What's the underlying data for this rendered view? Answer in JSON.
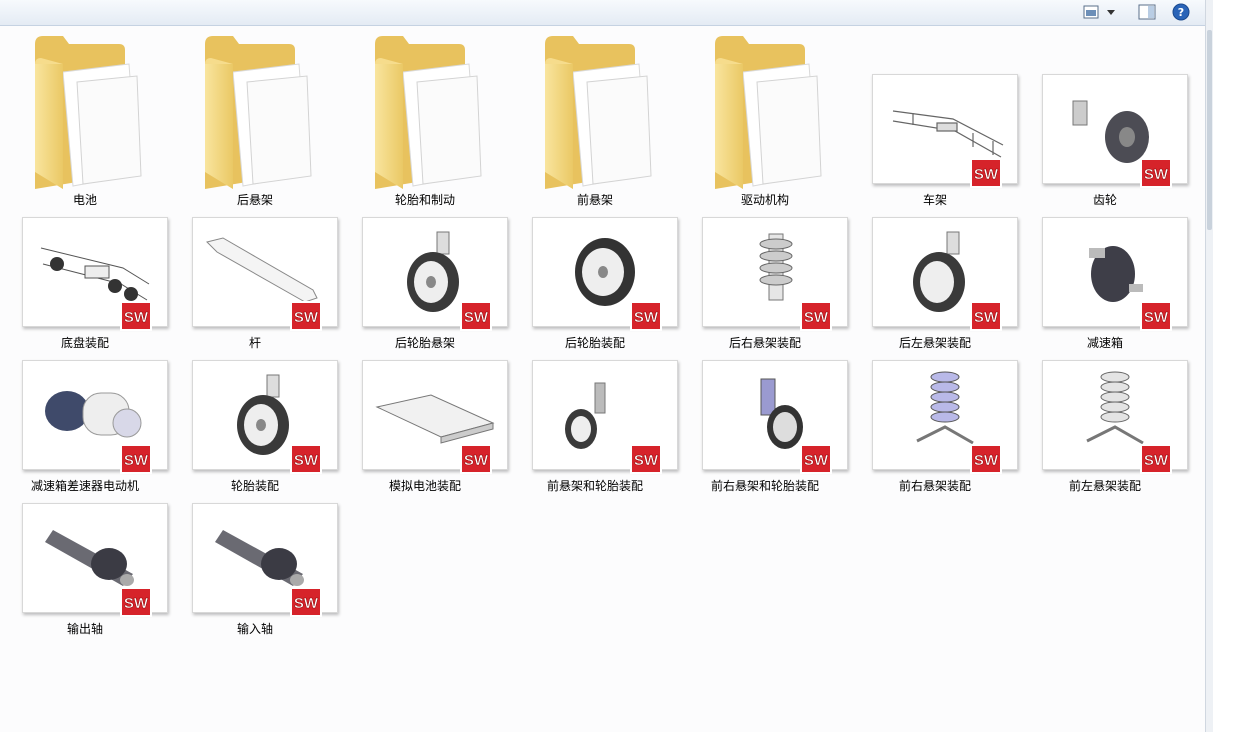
{
  "toolbar": {
    "view_icon": "view-icon",
    "dropdown_icon": "chevron-down-icon",
    "preview_icon": "preview-pane-icon",
    "help_icon": "help-icon",
    "help_glyph": "?"
  },
  "items": [
    {
      "label": "电池",
      "kind": "folder"
    },
    {
      "label": "后悬架",
      "kind": "folder"
    },
    {
      "label": "轮胎和制动",
      "kind": "folder"
    },
    {
      "label": "前悬架",
      "kind": "folder"
    },
    {
      "label": "驱动机构",
      "kind": "folder"
    },
    {
      "label": "车架",
      "kind": "file"
    },
    {
      "label": "齿轮",
      "kind": "file"
    },
    {
      "label": "底盘装配",
      "kind": "file"
    },
    {
      "label": "杆",
      "kind": "file"
    },
    {
      "label": "后轮胎悬架",
      "kind": "file"
    },
    {
      "label": "后轮胎装配",
      "kind": "file"
    },
    {
      "label": "后右悬架装配",
      "kind": "file"
    },
    {
      "label": "后左悬架装配",
      "kind": "file"
    },
    {
      "label": "减速箱",
      "kind": "file"
    },
    {
      "label": "减速箱差速器电动机",
      "kind": "file"
    },
    {
      "label": "轮胎装配",
      "kind": "file"
    },
    {
      "label": "模拟电池装配",
      "kind": "file"
    },
    {
      "label": "前悬架和轮胎装配",
      "kind": "file"
    },
    {
      "label": "前右悬架和轮胎装配",
      "kind": "file"
    },
    {
      "label": "前右悬架装配",
      "kind": "file"
    },
    {
      "label": "前左悬架装配",
      "kind": "file"
    },
    {
      "label": "输出轴",
      "kind": "file"
    },
    {
      "label": "输入轴",
      "kind": "file"
    }
  ],
  "sw_badge_text": "SW",
  "colors": {
    "folder": "#f2d27a",
    "sw_badge": "#d6232a"
  }
}
